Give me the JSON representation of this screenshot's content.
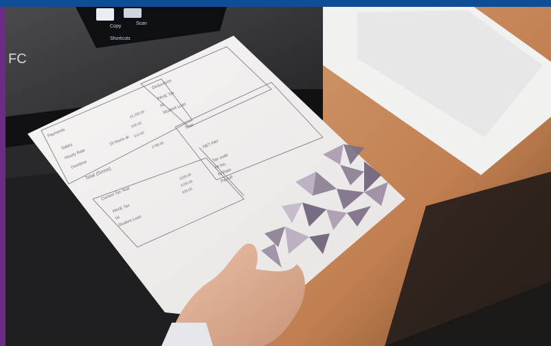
{
  "colors": {
    "brand_bar": "#0d4e96",
    "side_accent": "#6a2c86",
    "printer_body": "#3a3a3c",
    "desk_wood": "#c8885a",
    "paper": "#f2f0ef",
    "payslip_ink": "#6b6870",
    "triangle_pattern": "#8a7d92"
  },
  "printer": {
    "screen_labels": [
      "Copy",
      "Scan",
      "Shortcuts"
    ],
    "brand_fragment": "FC"
  },
  "payslip": {
    "deductions_header": "Deductions",
    "deductions_lines": [
      "PAYE Tax",
      "NI",
      "Student Loan"
    ],
    "total_label": "Total",
    "payments_header": "Payments",
    "payments_lines": [
      "Salary",
      "Hourly Rate",
      "Overtime"
    ],
    "hourly_rate_detail": "15 hours at",
    "total_gross_label": "Total (Gross)",
    "net_pay_header": "NET PAY",
    "net_pay_lines": [
      "Tax code",
      "NI No.",
      "NI Rate",
      "Payroll"
    ],
    "current_tax_year_header": "Current Tax Year",
    "current_tax_year_lines": [
      "PAYE Tax",
      "NI",
      "Student Loan"
    ],
    "amounts": [
      "£1,200.00",
      "£45.00",
      "£12.00",
      "£780.00",
      "£100.00",
      "£100.00",
      "£35.00"
    ]
  }
}
